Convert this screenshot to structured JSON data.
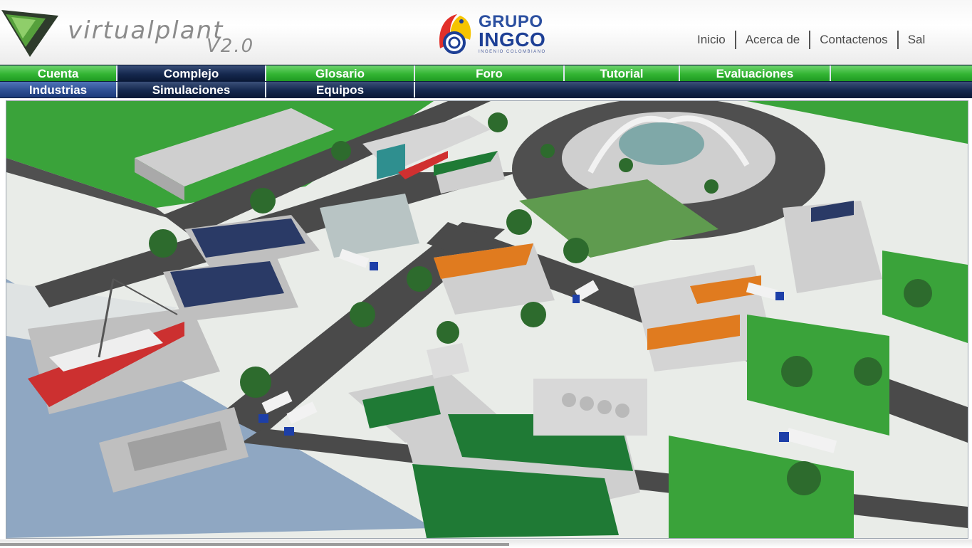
{
  "brand": {
    "logo_name": "virtualplant",
    "logo_version": "V2.0",
    "logo_colors": {
      "dark": "#2e3b2c",
      "green": "#56a03c"
    }
  },
  "partner": {
    "name_line1": "GRUPO",
    "name_line2": "INGCO",
    "tagline": "INGENIO COLOMBIANO",
    "colors": {
      "blue": "#1d3f95",
      "red": "#e2302a",
      "yellow": "#f5c400"
    }
  },
  "top_nav": {
    "items": [
      {
        "label": "Inicio"
      },
      {
        "label": "Acerca de"
      },
      {
        "label": "Contactenos"
      },
      {
        "label": "Sal"
      }
    ]
  },
  "main_menu": {
    "row1": [
      {
        "label": "Cuenta",
        "style": "green"
      },
      {
        "label": "Complejo",
        "style": "navy"
      },
      {
        "label": "Glosario",
        "style": "green"
      },
      {
        "label": "Foro",
        "style": "green"
      },
      {
        "label": "Tutorial",
        "style": "green"
      },
      {
        "label": "Evaluaciones",
        "style": "green"
      },
      {
        "label": "",
        "style": "green"
      }
    ],
    "row2": [
      {
        "label": "Industrias",
        "style": "blue"
      },
      {
        "label": "Simulaciones",
        "style": "navy"
      },
      {
        "label": "Equipos",
        "style": "navy"
      },
      {
        "label": "",
        "style": "navy"
      }
    ]
  },
  "scene": {
    "description_icons": [
      "industrial-complex-3d-map"
    ],
    "colors": {
      "grass": "#3aa33a",
      "road": "#4a4a4a",
      "water": "#8fa7c2",
      "building": "#d8d8d8",
      "roof_dark": "#2a3a66",
      "roof_orange": "#e07b1f",
      "roof_green": "#1f7a35",
      "truck_blue": "#1d3fa8"
    }
  }
}
